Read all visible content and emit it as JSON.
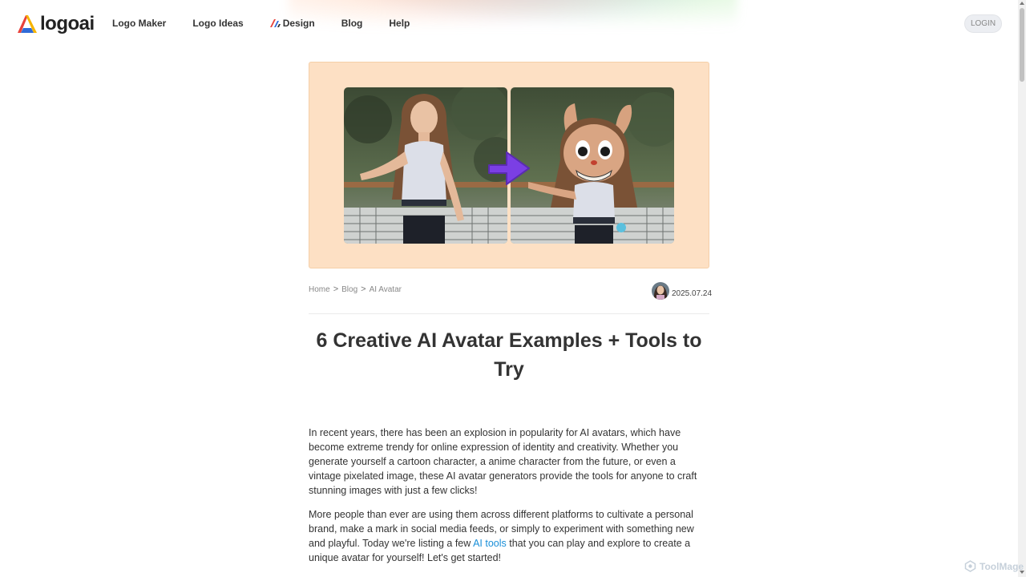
{
  "header": {
    "brand": "logoai",
    "nav": [
      {
        "label": "Logo Maker"
      },
      {
        "label": "Logo Ideas"
      },
      {
        "label": "Design"
      },
      {
        "label": "Blog"
      },
      {
        "label": "Help"
      }
    ],
    "login_label": "LOGIN"
  },
  "colors": {
    "hero_background": "#fde0c4",
    "link": "#1a8fd8",
    "arrow": "#7b3fe4"
  },
  "breadcrumb": {
    "items": [
      "Home",
      "Blog",
      "AI Avatar"
    ],
    "separator": ">"
  },
  "article": {
    "date": "2025.07.24",
    "title": "6 Creative AI Avatar Examples + Tools to Try",
    "p1": "In recent years, there has been an explosion in popularity for AI avatars, which have become extreme trendy for online expression of identity and creativity. Whether you generate yourself a cartoon character, a anime character from the future, or even a vintage pixelated image, these AI avatar generators provide the tools for anyone to craft stunning images with just a few clicks!",
    "p2_before": "More people than ever are using them across different platforms to cultivate a personal brand, make a mark in social media feeds, or simply to experiment with something new and playful. Today we're listing a few ",
    "p2_link": "AI tools",
    "p2_after": " that you can play and explore to create a unique avatar for yourself! Let's get started!"
  },
  "watermark": "ToolMage"
}
